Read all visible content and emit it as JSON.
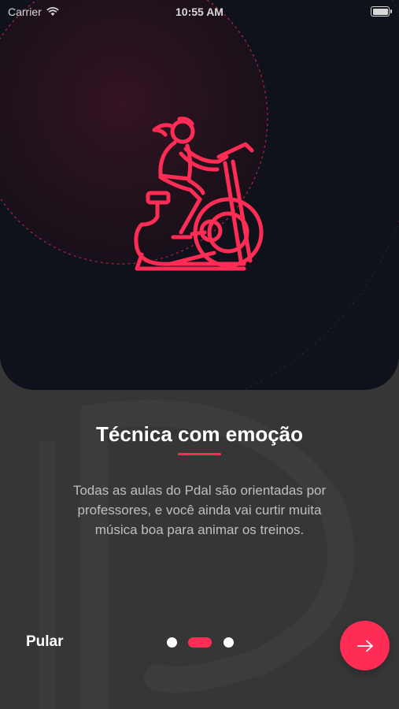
{
  "status_bar": {
    "carrier": "Carrier",
    "time": "10:55 AM"
  },
  "slide": {
    "title": "Técnica com emoção",
    "description": "Todas as aulas do Pdal são orientadas por professores, e você ainda vai curtir muita música boa para animar os treinos.",
    "illustration": "spin-bike-cyclist-icon"
  },
  "footer": {
    "skip_label": "Pular",
    "pages": 3,
    "active_page": 2,
    "next_icon": "arrow-right-icon"
  },
  "colors": {
    "accent": "#ff2d55",
    "hero_background": "#0f121a",
    "page_background": "#363636",
    "text_primary": "#ffffff",
    "text_secondary": "#bfbfbf"
  }
}
